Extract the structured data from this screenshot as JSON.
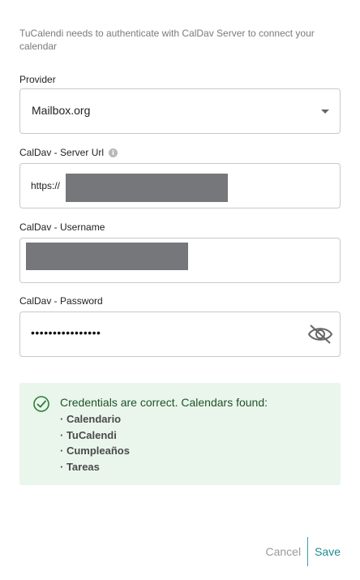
{
  "dialog": {
    "intro_text": "TuCalendi needs to authenticate with CalDav Server to connect your calendar"
  },
  "provider": {
    "label": "Provider",
    "selected": "Mailbox.org"
  },
  "server_url": {
    "label": "CalDav - Server Url",
    "prefix": "https://",
    "info_icon": "info-icon"
  },
  "username": {
    "label": "CalDav - Username"
  },
  "password": {
    "label": "CalDav - Password",
    "masked_value": "••••••••••••••••",
    "visibility_icon": "eye-off-icon"
  },
  "status": {
    "icon": "check-circle-icon",
    "message": "Credentials are correct. Calendars found:",
    "calendars": [
      "· Calendario",
      "· TuCalendi",
      "· Cumpleaños",
      "· Tareas"
    ],
    "color": "#eaf6ec"
  },
  "actions": {
    "cancel_label": "Cancel",
    "save_label": "Save",
    "accent_color": "#1e8a8f"
  }
}
